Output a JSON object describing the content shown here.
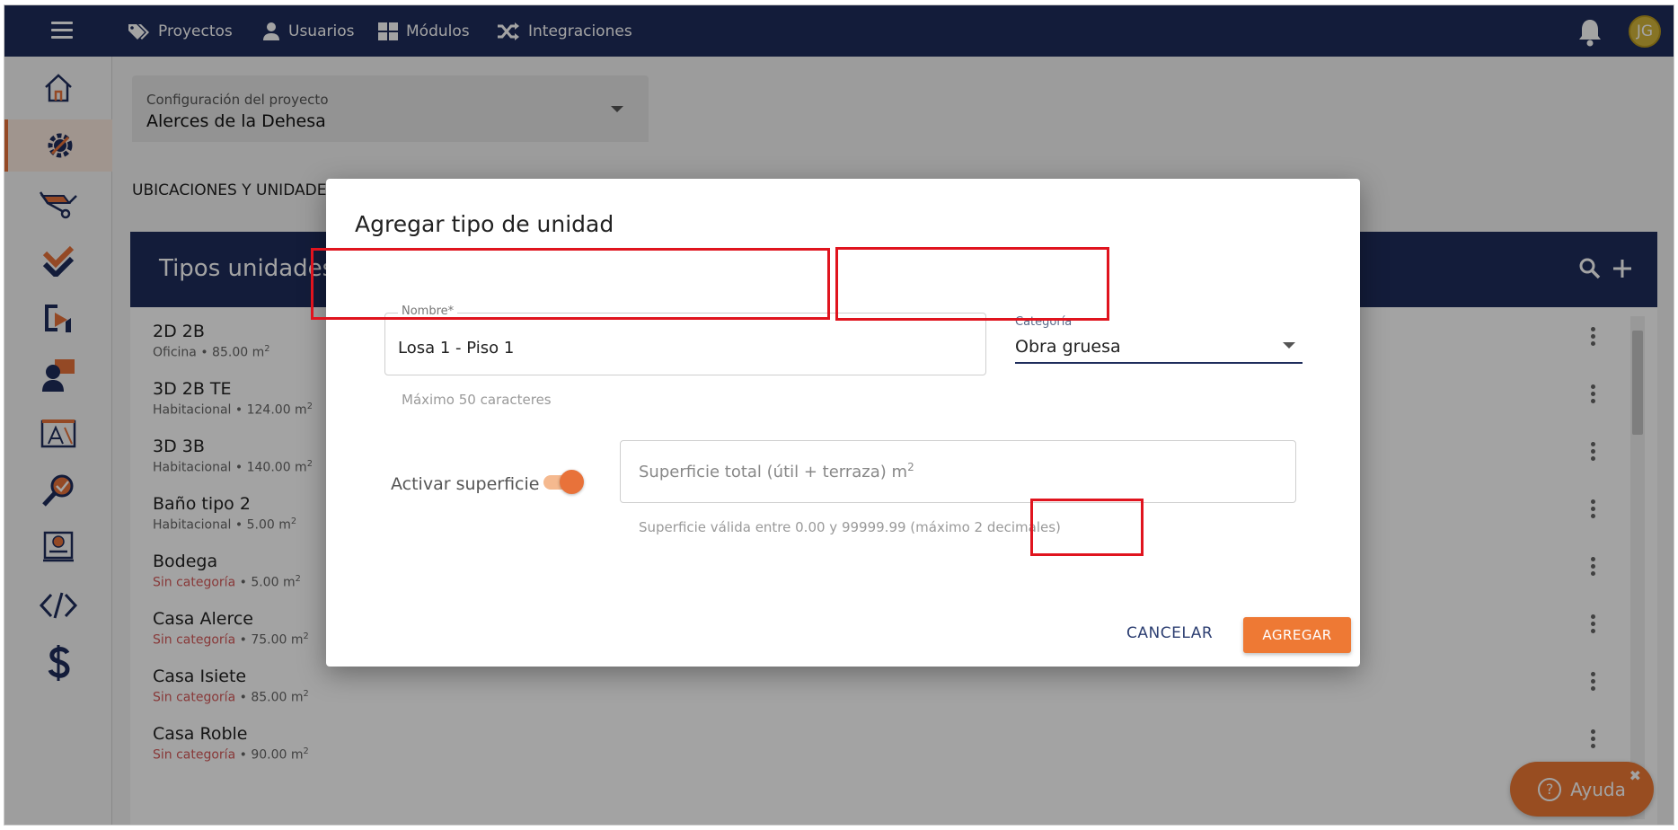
{
  "topbar": {
    "nav": [
      "Proyectos",
      "Usuarios",
      "Módulos",
      "Integraciones"
    ],
    "avatar_initials": "JG"
  },
  "project_selector": {
    "label": "Configuración del proyecto",
    "value": "Alerces de la Dehesa"
  },
  "section_title": "UBICACIONES Y UNIDADES",
  "list": {
    "title": "Tipos unidades",
    "rows": [
      {
        "name": "2D 2B",
        "category": "Oficina",
        "area": "• 85.00 m",
        "unit_sup": "2"
      },
      {
        "name": "3D 2B TE",
        "category": "Habitacional",
        "area": "• 124.00 m",
        "unit_sup": "2"
      },
      {
        "name": "3D 3B",
        "category": "Habitacional",
        "area": "• 140.00 m",
        "unit_sup": "2"
      },
      {
        "name": "Baño tipo 2",
        "category": "Habitacional",
        "area": "• 5.00 m",
        "unit_sup": "2"
      },
      {
        "name": "Bodega",
        "category": "Sin categoría",
        "area": "• 5.00 m",
        "unit_sup": "2"
      },
      {
        "name": "Casa Alerce",
        "category": "Sin categoría",
        "area": "• 75.00 m",
        "unit_sup": "2"
      },
      {
        "name": "Casa Isiete",
        "category": "Sin categoría",
        "area": "• 85.00 m",
        "unit_sup": "2"
      },
      {
        "name": "Casa Roble",
        "category": "Sin categoría",
        "area": "• 90.00 m",
        "unit_sup": "2"
      }
    ]
  },
  "modal": {
    "title": "Agregar tipo de unidad",
    "nombre_label": "Nombre*",
    "nombre_value": "Losa 1 - Piso 1",
    "nombre_hint": "Máximo 50 caracteres",
    "categoria_label": "Categoría",
    "categoria_value": "Obra gruesa",
    "toggle_label": "Activar superficie",
    "superficie_placeholder": "Superficie total (útil + terraza) m",
    "superficie_sup": "2",
    "superficie_hint": "Superficie válida entre 0.00 y 99999.99 (máximo 2 decimales)",
    "cancel_label": "CANCELAR",
    "add_label": "AGREGAR"
  },
  "help": {
    "label": "Ayuda",
    "close": "✖"
  },
  "colors": {
    "navy": "#1e2d5c",
    "accent_orange": "#ee7934",
    "highlight_red": "#e0141e"
  }
}
